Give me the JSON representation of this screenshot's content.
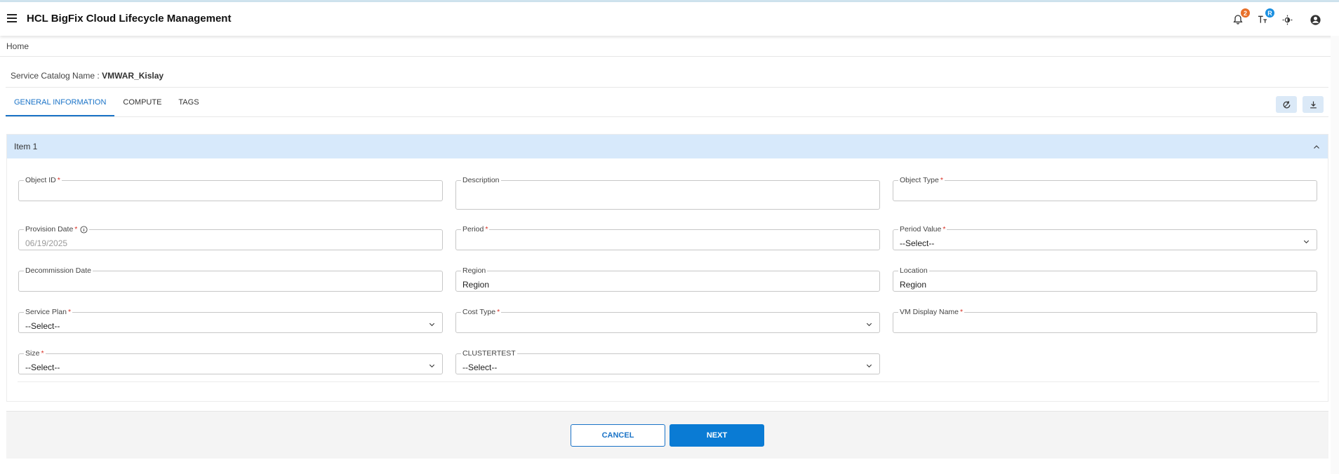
{
  "header": {
    "app_title": "HCL BigFix Cloud Lifecycle Management",
    "notification_count": "2",
    "translate_badge": "R",
    "notification_badge_color": "#e8702a",
    "translate_badge_color": "#1a8fe0"
  },
  "breadcrumb": {
    "home": "Home"
  },
  "catalog": {
    "label": "Service Catalog Name :",
    "name": "VMWAR_Kislay"
  },
  "tabs": [
    {
      "label": "GENERAL INFORMATION",
      "active": true
    },
    {
      "label": "COMPUTE",
      "active": false
    },
    {
      "label": "TAGS",
      "active": false
    }
  ],
  "panel": {
    "title": "Item 1"
  },
  "fields": {
    "object_id": {
      "label": "Object ID",
      "required": "*",
      "value": ""
    },
    "description": {
      "label": "Description",
      "value": ""
    },
    "object_type": {
      "label": "Object Type",
      "required": "*",
      "value": ""
    },
    "provision_date": {
      "label": "Provision Date",
      "required": "*",
      "placeholder": "06/19/2025"
    },
    "period": {
      "label": "Period",
      "required": "*",
      "value": ""
    },
    "period_value": {
      "label": "Period Value",
      "required": "*",
      "value": "--Select--"
    },
    "decommission_date": {
      "label": "Decommission Date",
      "value": ""
    },
    "region": {
      "label": "Region",
      "value": "Region"
    },
    "location": {
      "label": "Location",
      "value": "Region"
    },
    "service_plan": {
      "label": "Service Plan",
      "required": "*",
      "value": "--Select--"
    },
    "cost_type": {
      "label": "Cost Type",
      "required": "*",
      "value": ""
    },
    "vm_display_name": {
      "label": "VM Display Name",
      "required": "*",
      "value": ""
    },
    "size": {
      "label": "Size",
      "required": "*",
      "value": "--Select--"
    },
    "clustertest": {
      "label": "CLUSTERTEST",
      "value": "--Select--"
    }
  },
  "buttons": {
    "cancel": "CANCEL",
    "next": "NEXT"
  },
  "colors": {
    "accent": "#1a73c7",
    "primary_button": "#0a7bd4",
    "panel_header": "#d7e9fb",
    "required": "#d93025"
  }
}
